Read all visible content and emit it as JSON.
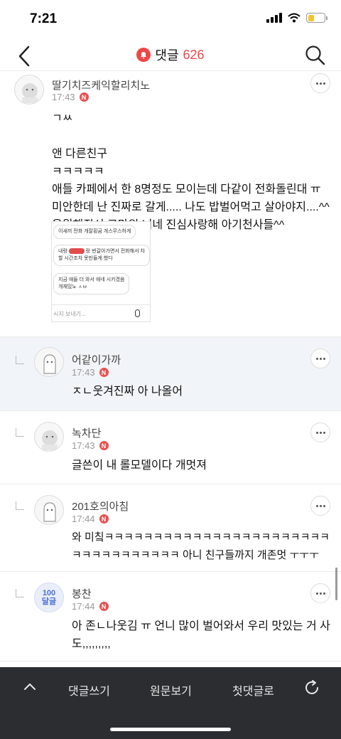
{
  "status_bar": {
    "time": "7:21"
  },
  "header": {
    "title": "댓글",
    "count": "626",
    "icons": [
      "back-arrow-icon",
      "bell-icon",
      "search-icon"
    ]
  },
  "comments": [
    {
      "username": "딸기치즈케익할리치노",
      "time": "17:43",
      "badge": "N",
      "lines": [
        "ㄱㅆ",
        "",
        "앤 다른친구",
        "ㅋㅋㅋㅋㅋ",
        "애들 카페에서 한 8명정도 모이는데 다같이 전화돌린대 ㅠ",
        "미안한데 난 진짜로 갈게..... 나도 밥벌어먹고 살아야지....^^",
        "응원해줘서 고마워 너네 진심사랑해 아기천사들^^"
      ],
      "attachment": {
        "bubble1": "이새끼 전화 개잘횡굼 개스무스하게",
        "bubble2_a": "내랑",
        "bubble2_b": "랑 번갈아가면서 전화해서 차",
        "bubble2_c": "할 시간조차 못만들게 했다",
        "bubble3_a": "지금 애들 더 와서 애네 시키겠음",
        "bubble3_b": "개재밌노 ㅅㅂ",
        "input_placeholder": "시지 보내기..."
      }
    },
    {
      "username": "어같이가까",
      "time": "17:43",
      "badge": "N",
      "lines": [
        "ㅈㄴ웃겨진짜 아 나올어"
      ]
    },
    {
      "username": "녹차단",
      "time": "17:43",
      "badge": "N",
      "lines": [
        "글쓴이 내 롤모델이다 개멋져"
      ]
    },
    {
      "username": "201호의아침",
      "time": "17:44",
      "badge": "N",
      "lines": [
        "와 미칰ㅋㅋㅋㅋㅋㅋㅋㅋㅋㅋㅋㅋㅋㅋㅋㅋㅋㅋㅋㅋㅋㅋㅋ",
        "ㅋㅋㅋㅋㅋㅋㅋㅋㅋㅋㅋ 아니 친구들까지 개존멋 ㅜㅜㅜ"
      ]
    },
    {
      "username": "봉찬",
      "time": "17:44",
      "badge": "N",
      "avatar_text": "100 달글",
      "lines": [
        "아 존ㄴ나웃김 ㅠ 언니 많이 벌어와서 우리 맛있는 거 사",
        "도,,,,,,,,,"
      ]
    }
  ],
  "bottom_bar": {
    "write": "댓글쓰기",
    "original": "원문보기",
    "first": "첫댓글로"
  },
  "colors": {
    "accent": "#f04646",
    "highlight_bg": "#f1f4f8",
    "bottom_bar": "#2b2d30"
  }
}
